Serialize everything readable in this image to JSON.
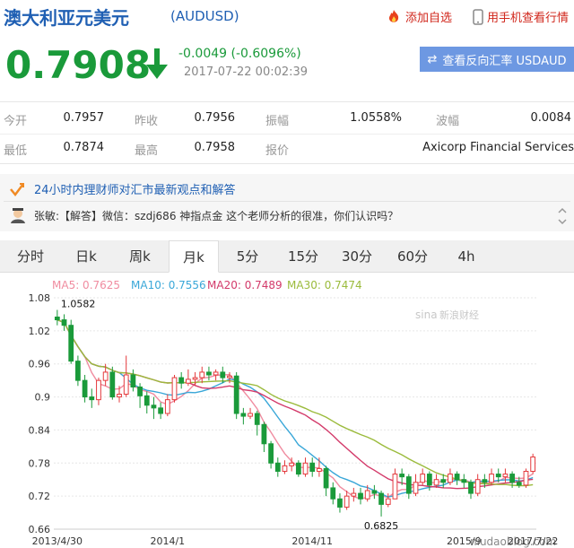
{
  "header": {
    "title": "澳大利亚元美元",
    "code": "(AUDUSD)",
    "favorite_label": "添加自选",
    "mobile_label": "用手机查看行情"
  },
  "quote": {
    "price": "0.7908",
    "change": "-0.0049 (-0.6096%)",
    "time": "2017-07-22 00:02:39",
    "reverse_label": "查看反向汇率 USDAUD",
    "trend_color": "#1a9a3a"
  },
  "stats": {
    "open_label": "今开",
    "open": "0.7957",
    "prev_close_label": "昨收",
    "prev_close": "0.7956",
    "amplitude_label": "振幅",
    "amplitude": "1.0558%",
    "wave_label": "波幅",
    "wave": "0.0084",
    "low_label": "最低",
    "low": "0.7874",
    "high_label": "最高",
    "high": "0.7958",
    "quote_label": "报价",
    "quote_source": "Axicorp Financial Services"
  },
  "notice": {
    "headline": "24小时内理财师对汇市最新观点和解答",
    "message": "张敏:【解答】微信：szdj686 神指点金 这个老师分析的很准，你们认识吗？"
  },
  "tabs": [
    "分时",
    "日k",
    "周k",
    "月k",
    "5分",
    "15分",
    "30分",
    "60分",
    "4h"
  ],
  "active_tab": "月k",
  "chart_labels": {
    "ma5": "MA5: 0.7625",
    "ma10": "MA10: 0.7556",
    "ma20": "MA20: 0.7489",
    "ma30": "MA30: 0.7474",
    "watermark": "新浪财经",
    "site_watermark": "niudaoblog.com",
    "high_annot": "1.0582",
    "low_annot": "0.6825"
  },
  "colors": {
    "up": "#e4393c",
    "down": "#1a9a3a",
    "ma5": "#f08ca0",
    "ma10": "#3aa7d8",
    "ma20": "#d33a6a",
    "ma30": "#9bbb3c"
  },
  "chart_data": {
    "type": "candlestick",
    "y_ticks": [
      1.08,
      1.02,
      0.96,
      0.9,
      0.84,
      0.78,
      0.72,
      0.66
    ],
    "ylim": [
      0.66,
      1.08
    ],
    "x_ticks": [
      "2013/4/30",
      "2014/1",
      "2014/11",
      "2015/9",
      "2016/7",
      "2017/7/22"
    ],
    "annotations": [
      {
        "label": "1.0582",
        "value": 1.0582
      },
      {
        "label": "0.6825",
        "value": 0.6825
      }
    ],
    "candles": [
      [
        1.045,
        1.04,
        1.058,
        1.03
      ],
      [
        1.04,
        1.03,
        1.05,
        1.02
      ],
      [
        1.03,
        0.965,
        1.04,
        0.96
      ],
      [
        0.965,
        0.93,
        0.975,
        0.92
      ],
      [
        0.93,
        0.9,
        0.94,
        0.89
      ],
      [
        0.9,
        0.895,
        0.915,
        0.88
      ],
      [
        0.895,
        0.93,
        0.935,
        0.885
      ],
      [
        0.93,
        0.945,
        0.96,
        0.92
      ],
      [
        0.945,
        0.9,
        0.955,
        0.895
      ],
      [
        0.9,
        0.905,
        0.92,
        0.89
      ],
      [
        0.905,
        0.94,
        0.975,
        0.9
      ],
      [
        0.94,
        0.918,
        0.95,
        0.91
      ],
      [
        0.918,
        0.902,
        0.925,
        0.88
      ],
      [
        0.902,
        0.885,
        0.91,
        0.87
      ],
      [
        0.885,
        0.88,
        0.9,
        0.86
      ],
      [
        0.88,
        0.87,
        0.89,
        0.86
      ],
      [
        0.87,
        0.895,
        0.905,
        0.865
      ],
      [
        0.895,
        0.935,
        0.94,
        0.89
      ],
      [
        0.935,
        0.925,
        0.945,
        0.915
      ],
      [
        0.925,
        0.932,
        0.95,
        0.92
      ],
      [
        0.932,
        0.935,
        0.945,
        0.92
      ],
      [
        0.935,
        0.945,
        0.955,
        0.925
      ],
      [
        0.945,
        0.94,
        0.955,
        0.93
      ],
      [
        0.94,
        0.945,
        0.95,
        0.93
      ],
      [
        0.945,
        0.935,
        0.955,
        0.925
      ],
      [
        0.935,
        0.938,
        0.945,
        0.925
      ],
      [
        0.938,
        0.87,
        0.945,
        0.86
      ],
      [
        0.87,
        0.865,
        0.88,
        0.85
      ],
      [
        0.865,
        0.87,
        0.88,
        0.86
      ],
      [
        0.87,
        0.85,
        0.875,
        0.83
      ],
      [
        0.85,
        0.815,
        0.855,
        0.8
      ],
      [
        0.815,
        0.78,
        0.82,
        0.77
      ],
      [
        0.78,
        0.765,
        0.79,
        0.755
      ],
      [
        0.765,
        0.775,
        0.785,
        0.76
      ],
      [
        0.775,
        0.78,
        0.79,
        0.765
      ],
      [
        0.78,
        0.76,
        0.785,
        0.755
      ],
      [
        0.76,
        0.78,
        0.79,
        0.755
      ],
      [
        0.78,
        0.765,
        0.79,
        0.755
      ],
      [
        0.765,
        0.77,
        0.79,
        0.755
      ],
      [
        0.77,
        0.735,
        0.775,
        0.72
      ],
      [
        0.735,
        0.715,
        0.745,
        0.705
      ],
      [
        0.715,
        0.7,
        0.725,
        0.69
      ],
      [
        0.7,
        0.72,
        0.73,
        0.695
      ],
      [
        0.72,
        0.725,
        0.735,
        0.71
      ],
      [
        0.725,
        0.715,
        0.735,
        0.705
      ],
      [
        0.715,
        0.73,
        0.74,
        0.71
      ],
      [
        0.73,
        0.725,
        0.74,
        0.715
      ],
      [
        0.725,
        0.705,
        0.73,
        0.683
      ],
      [
        0.705,
        0.715,
        0.725,
        0.7
      ],
      [
        0.715,
        0.76,
        0.77,
        0.715
      ],
      [
        0.76,
        0.755,
        0.77,
        0.74
      ],
      [
        0.755,
        0.725,
        0.76,
        0.715
      ],
      [
        0.725,
        0.745,
        0.76,
        0.72
      ],
      [
        0.745,
        0.76,
        0.77,
        0.74
      ],
      [
        0.76,
        0.74,
        0.765,
        0.73
      ],
      [
        0.74,
        0.75,
        0.76,
        0.735
      ],
      [
        0.75,
        0.745,
        0.76,
        0.735
      ],
      [
        0.745,
        0.76,
        0.77,
        0.74
      ],
      [
        0.76,
        0.75,
        0.765,
        0.74
      ],
      [
        0.75,
        0.745,
        0.76,
        0.735
      ],
      [
        0.745,
        0.725,
        0.75,
        0.715
      ],
      [
        0.725,
        0.75,
        0.76,
        0.72
      ],
      [
        0.75,
        0.745,
        0.76,
        0.735
      ],
      [
        0.745,
        0.76,
        0.77,
        0.74
      ],
      [
        0.76,
        0.755,
        0.77,
        0.745
      ],
      [
        0.755,
        0.76,
        0.77,
        0.745
      ],
      [
        0.76,
        0.745,
        0.765,
        0.735
      ],
      [
        0.745,
        0.74,
        0.755,
        0.735
      ],
      [
        0.74,
        0.765,
        0.77,
        0.735
      ],
      [
        0.765,
        0.791,
        0.797,
        0.76
      ]
    ]
  }
}
